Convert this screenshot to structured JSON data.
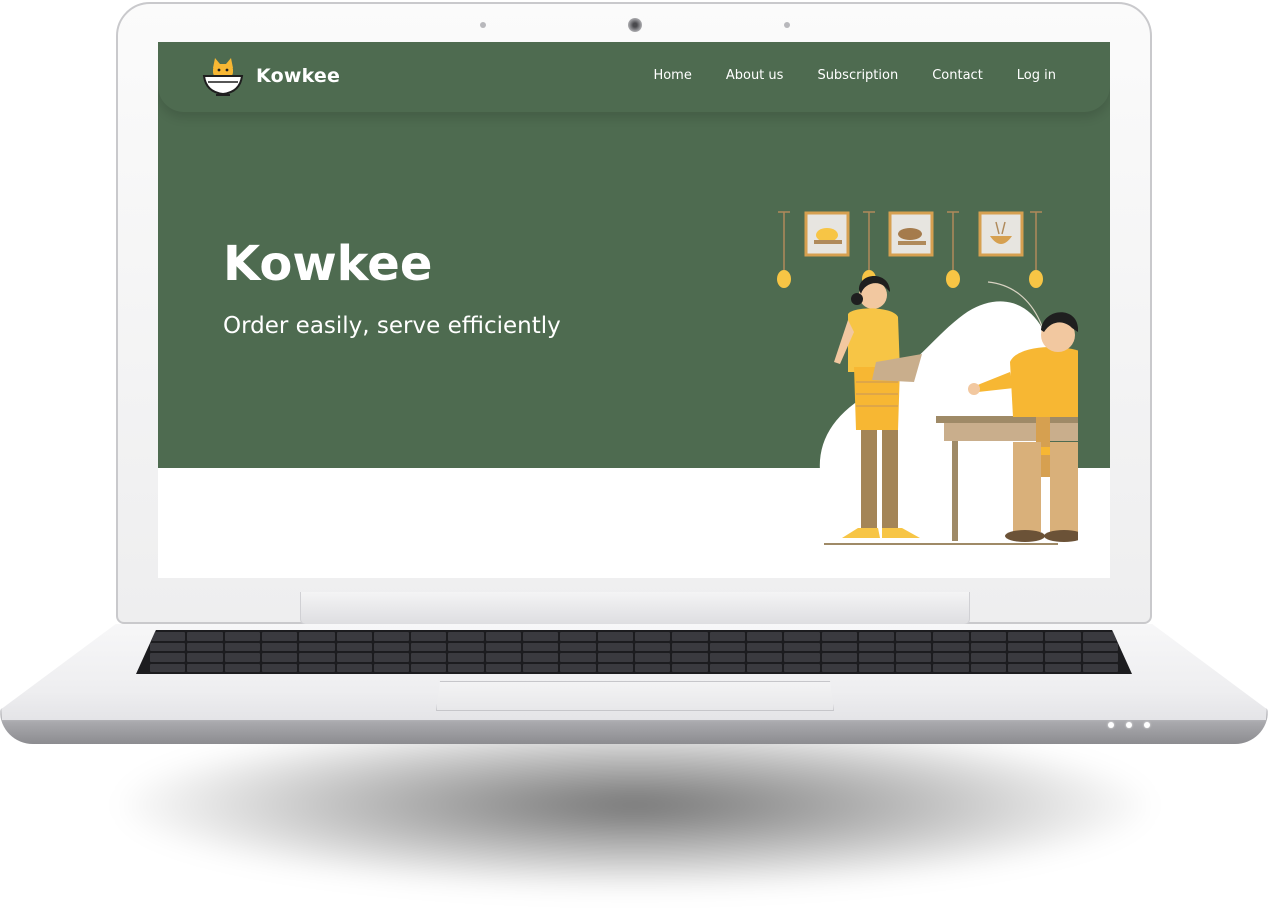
{
  "brand": {
    "name": "Kowkee",
    "logo_icon": "cat-in-bowl-icon"
  },
  "nav": {
    "items": [
      {
        "label": "Home"
      },
      {
        "label": "About us"
      },
      {
        "label": "Subscription"
      },
      {
        "label": "Contact"
      },
      {
        "label": "Log in"
      }
    ]
  },
  "hero": {
    "title": "Kowkee",
    "subtitle": "Order easily, serve efficiently",
    "illustration": "waiter-taking-order-illustration"
  },
  "colors": {
    "hero_background": "#4e6b50",
    "accent_yellow": "#f7b733",
    "text": "#ffffff"
  }
}
